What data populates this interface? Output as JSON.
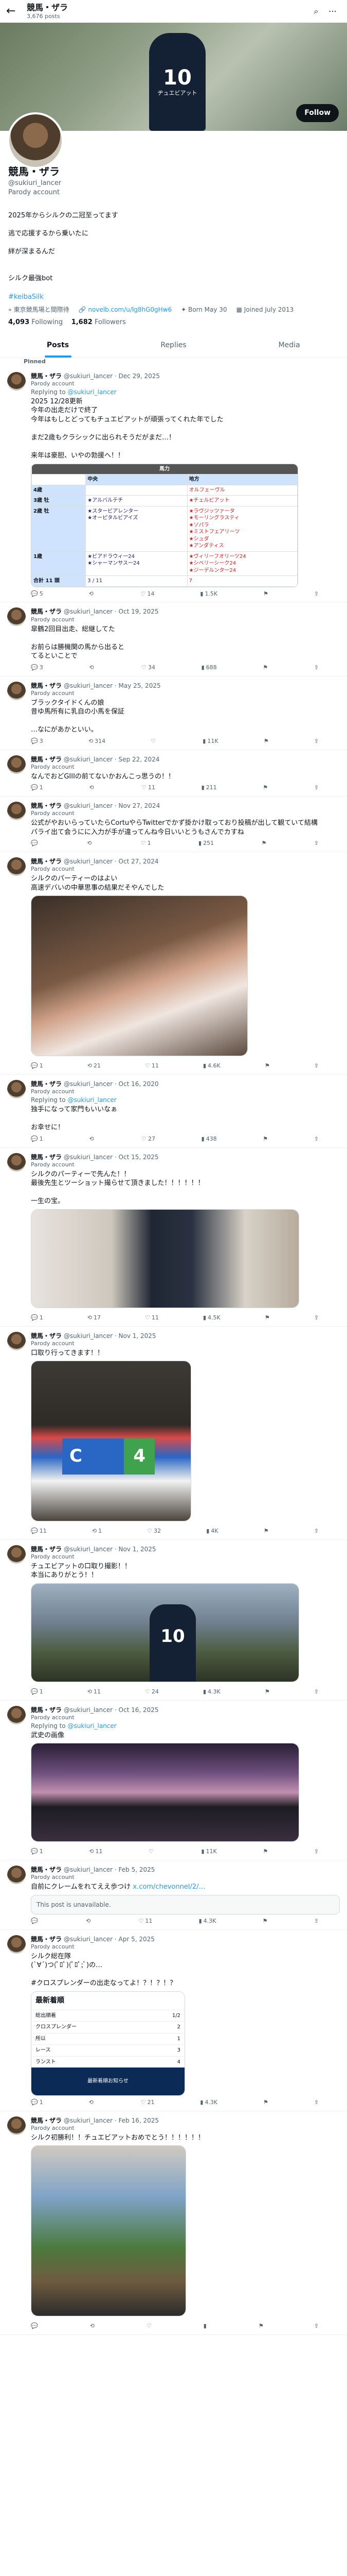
{
  "header": {
    "name": "競馬・ザラ",
    "posts": "3,676 posts"
  },
  "banner": {
    "number": "10",
    "sign": "ヂュエビアット"
  },
  "profile": {
    "name": "競馬・ザラ",
    "handle": "@sukiuri_lancer",
    "parody": "Parody account",
    "bio_lines": [
      "2025年からシルクの二冠至ってます",
      "逃で応援するから乗いたに",
      "絆が深まるんだ",
      "",
      "シルク最強bot"
    ],
    "bio_link": "#keibaSilk",
    "follow": "Follow",
    "location": "東京競馬場と間際待",
    "website": "novelb.com/u/lg8hG0gHw6",
    "born": "Born May 30",
    "joined": "Joined July 2013",
    "following": "4,093",
    "following_label": "Following",
    "followers": "1,682",
    "followers_label": "Followers"
  },
  "tabs": [
    "Posts",
    "Replies",
    "Media"
  ],
  "pinned_label": "Pinned",
  "posts": [
    {
      "author": "競馬・ザラ",
      "handle": "@sukiuri_lancer",
      "date": "Dec 29, 2025",
      "parody": "Parody account",
      "reply_to": "@sukiuri_lancer",
      "text": "2025 12/28更新\n今年の出走だけで終了\n今年はもしとどってもチュエビアットが頑張ってくれた年でした\n\nまだ2歳もクラシックに出られそうだがまだ…！\n\n来年は豪胆、いやの勃援へ！！",
      "stats": [
        "5",
        "",
        "14",
        "1.5K"
      ],
      "table": {
        "title": "馬力",
        "cols": [
          "中央",
          "地方"
        ],
        "rows": [
          [
            "4歳",
            "",
            "オルフェーヴル"
          ],
          [
            "3歳 牡",
            "★アルバルテチ",
            "★チェルビアット"
          ],
          [
            "2歳 牡",
            "★スタービアレンター\n★オーピタルビアイズ",
            "★ラヴジッツァータ\n★モーリングラスティ\n★ソパラ\n★ミストフェアリーツ\n★シュダ\n★アンダティス"
          ],
          [
            "1歳",
            "★ビアドラウィ一24\n★シャーマンサス一24",
            "★ヴィリーフオリーツ24\n★シベリーシーク24\n★ジーデルンタ一24"
          ]
        ],
        "total": [
          "合計 11 頭",
          "3",
          "11",
          "7"
        ]
      }
    },
    {
      "author": "競馬・ザラ",
      "handle": "@sukiuri_lancer",
      "date": "Oct 19, 2025",
      "parody": "Parody account",
      "text": "皐鶴2回目出走、総継してた\n\nお前らは勝機関の馬から出ると\nてるといことで",
      "stats": [
        "3",
        "",
        "34",
        "688"
      ]
    },
    {
      "author": "競馬・ザラ",
      "handle": "@sukiuri_lancer",
      "date": "May 25, 2025",
      "parody": "Parody account",
      "text": "ブラックタイドくんの娘\n昔ゆ馬所有に乳自の小馬を保証\n\n…なにがあかといい。",
      "stats": [
        "3",
        "314",
        "",
        "11K"
      ]
    },
    {
      "author": "競馬・ザラ",
      "handle": "@sukiuri_lancer",
      "date": "Sep 22, 2024",
      "parody": "Parody account",
      "text": "なんでおどGIIIの前てないかおんこっ思うの！！",
      "stats": [
        "1",
        "",
        "11",
        "211"
      ]
    },
    {
      "author": "競馬・ザラ",
      "handle": "@sukiuri_lancer",
      "date": "Nov 27, 2024",
      "parody": "Parody account",
      "text": "公式がやおいらっていたらCortuやらTwitterでかず掛かけ取っており投稿が出して観ていて結構\nパライ出て会うにに入力が手が違ってんね今日いいとうもさんでカすね",
      "stats": [
        "",
        "",
        "1",
        "251"
      ]
    },
    {
      "author": "競馬・ザラ",
      "handle": "@sukiuri_lancer",
      "date": "Oct 27, 2024",
      "parody": "Parody account",
      "text": "シルクのパーティーのはよい\n高速デバいの中華思事の結果だそやんでした",
      "stats": [
        "1",
        "21",
        "11",
        "4.6K"
      ],
      "image": "img1"
    },
    {
      "author": "競馬・ザラ",
      "handle": "@sukiuri_lancer",
      "date": "Oct 16, 2020",
      "parody": "Parody account",
      "reply_to": "@sukiuri_lancer",
      "text": "独手になって家門もいいなぁ\n\nお幸せに！",
      "stats": [
        "1",
        "",
        "27",
        "438"
      ]
    },
    {
      "author": "競馬・ザラ",
      "handle": "@sukiuri_lancer",
      "date": "Oct 15, 2025",
      "parody": "Parody account",
      "text": "シルクのパーティーで先んた！！\n最後先生とツーショット撮らせて頂きました！！！！！！\n\n一生の宝。",
      "stats": [
        "1",
        "17",
        "11",
        "4.5K"
      ],
      "image": "img2"
    },
    {
      "author": "競馬・ザラ",
      "handle": "@sukiuri_lancer",
      "date": "Nov 1, 2025",
      "parody": "Parody account",
      "text": "口取り行ってきます！！",
      "stats": [
        "11",
        "1",
        "32",
        "4K"
      ],
      "image": "img3",
      "tag": [
        "C",
        "4"
      ]
    },
    {
      "author": "競馬・ザラ",
      "handle": "@sukiuri_lancer",
      "date": "Nov 1, 2025",
      "parody": "Parody account",
      "text": "チュエビアットの口取り撮影！！\n本当にありがとう！！",
      "stats": [
        "1",
        "11",
        "24",
        "4.3K"
      ],
      "image": "img4",
      "tag": [
        "10"
      ]
    },
    {
      "author": "競馬・ザラ",
      "handle": "@sukiuri_lancer",
      "date": "Oct 16, 2025",
      "parody": "Parody account",
      "reply_to": "@sukiuri_lancer",
      "text": "武史の画像",
      "stats": [
        "1",
        "11",
        "",
        "11K"
      ],
      "image": "img5"
    },
    {
      "author": "競馬・ザラ",
      "handle": "@sukiuri_lancer",
      "date": "Feb 5, 2025",
      "parody": "Parody account",
      "text": "自前にクレームをれてええ歩つけ",
      "link": "x.com/chevonnel/2/…",
      "card": "This post is unavailable.",
      "stats": [
        "",
        "",
        "11",
        "4.3K"
      ]
    },
    {
      "author": "競馬・ザラ",
      "handle": "@sukiuri_lancer",
      "date": "Apr 5, 2025",
      "parody": "Parody account",
      "text": "シルク総在隊\n(`∀´)つ(ﾟﾛﾟ)(ﾟﾛﾟ;ﾞ)の…\n\n#クロスプレンダーの出走なってよ！？！？！？",
      "stats": [
        "1",
        "",
        "21",
        "4.3K"
      ],
      "app": {
        "title": "最新着順",
        "rows": [
          [
            "総出順着",
            "1/2"
          ],
          [
            "クロスプレンダー",
            "2"
          ],
          [
            "所以",
            "1"
          ],
          [
            "レース",
            "3"
          ],
          [
            "ランスト",
            "4"
          ]
        ],
        "footer": "最新着順お知らせ"
      }
    },
    {
      "author": "競馬・ザラ",
      "handle": "@sukiuri_lancer",
      "date": "Feb 16, 2025",
      "parody": "Parody account",
      "text": "シルク初勝利！！チュエビアットおめでとう！！！！！！",
      "stats": [
        "",
        "",
        "",
        ""
      ],
      "image": "img6"
    }
  ]
}
